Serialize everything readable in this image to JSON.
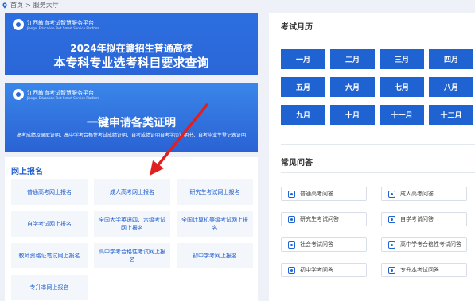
{
  "breadcrumb": {
    "home": "首页",
    "sep": ">",
    "current": "服务大厅"
  },
  "banner1": {
    "logo_cn": "江西教育考试智慧服务平台",
    "logo_en": "Jiangxi Education Test Smart Service Platform",
    "line1": "2024年拟在赣招生普通高校",
    "line2": "本专科专业选考科目要求查询"
  },
  "banner2": {
    "logo_cn": "江西教育考试智慧服务平台",
    "logo_en": "Jiangxi Education Test Smart Service Platform",
    "title": "一键申请各类证明",
    "subtitle": "高考成绩及录取证明、高中学考合格性考试成绩证明、自考成绩证明自考学历证明书、自考毕业生登记表证明"
  },
  "registration": {
    "title": "网上报名",
    "items": [
      {
        "label": "普通高考网上报名"
      },
      {
        "label": "成人高考网上报名"
      },
      {
        "label": "研究生考试网上报名"
      },
      {
        "label": "自学考试网上报名"
      },
      {
        "label": "全国大学英语四、六级考试网上报名"
      },
      {
        "label": "全国计算机等级考试网上报名"
      },
      {
        "label": "教师资格证笔试网上报名"
      },
      {
        "label": "高中学考合格性考试网上报名"
      },
      {
        "label": "初中学考网上报名"
      },
      {
        "label": "专升本网上报名"
      }
    ]
  },
  "calendar": {
    "title": "考试月历",
    "months": [
      "一月",
      "二月",
      "三月",
      "四月",
      "五月",
      "六月",
      "七月",
      "八月",
      "九月",
      "十月",
      "十一月",
      "十二月"
    ]
  },
  "faq": {
    "title": "常见问答",
    "items": [
      {
        "label": "普通高考问答"
      },
      {
        "label": "成人高考问答"
      },
      {
        "label": "研究生考试问答"
      },
      {
        "label": "自学考试问答"
      },
      {
        "label": "社会考试问答"
      },
      {
        "label": "高中学考合格性考试问答"
      },
      {
        "label": "初中学考问答"
      },
      {
        "label": "专升本考试问答"
      }
    ]
  },
  "colors": {
    "brand": "#1f63d3",
    "arrow": "#e02020",
    "panel_bg": "#eef2f8"
  }
}
